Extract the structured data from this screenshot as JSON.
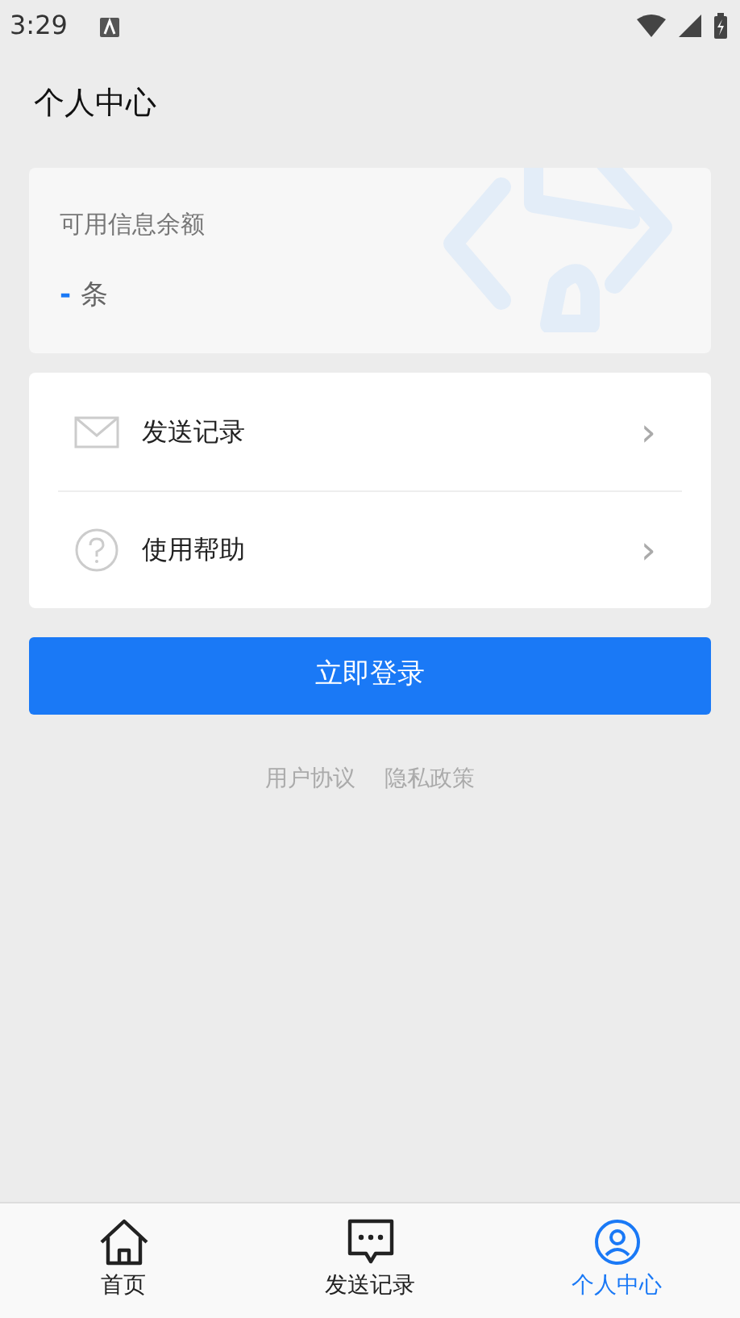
{
  "status_bar": {
    "time": "3:29"
  },
  "header": {
    "title": "个人中心"
  },
  "balance": {
    "label": "可用信息余额",
    "value": "-",
    "unit": "条"
  },
  "menu": [
    {
      "kind": "mail",
      "label": "发送记录",
      "chevron": "›"
    },
    {
      "kind": "help",
      "label": "使用帮助",
      "chevron": "›"
    }
  ],
  "login_button": "立即登录",
  "links": [
    "用户协议",
    "隐私政策"
  ],
  "tabs": [
    {
      "kind": "home",
      "label": "首页",
      "selected": false
    },
    {
      "kind": "chat",
      "label": "发送记录",
      "selected": false
    },
    {
      "kind": "person",
      "label": "个人中心",
      "selected": true
    }
  ]
}
